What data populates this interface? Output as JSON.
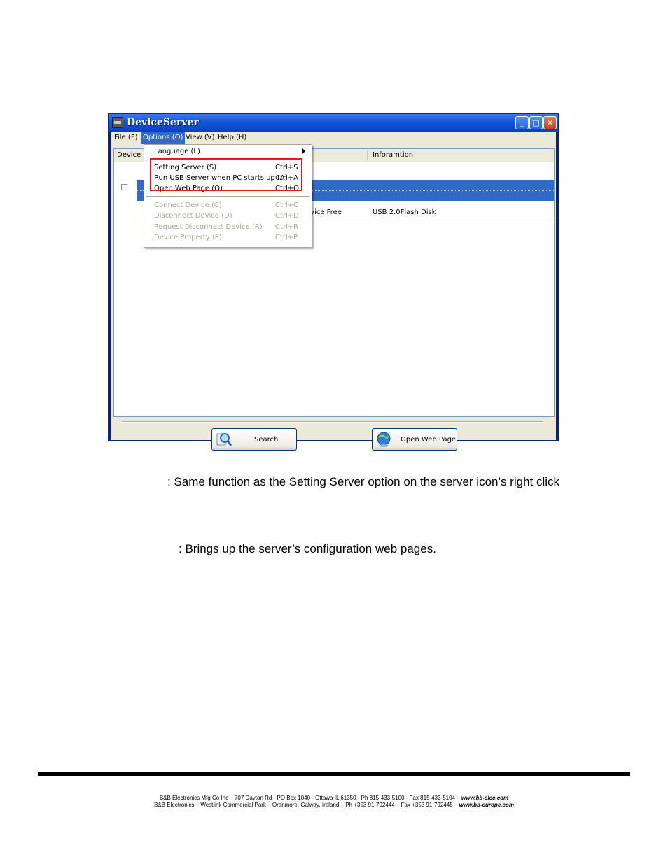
{
  "window": {
    "title": "DeviceServer",
    "minimize_glyph": "_",
    "maximize_glyph": "□",
    "close_glyph": "✕"
  },
  "menubar": {
    "items": [
      "File (F)",
      "Options (O)",
      "View (V)",
      "Help (H)"
    ]
  },
  "list": {
    "col_device": "Device",
    "col_information": "Inforamtion",
    "row_status": "evice Free",
    "row_information": "USB 2.0Flash Disk"
  },
  "options_menu": {
    "language": "Language (L)",
    "setting_server": "Setting Server (S)",
    "setting_server_sc": "Ctrl+S",
    "run_usb_server": "Run USB Server when PC starts up (A)",
    "run_usb_server_sc": "Ctrl+A",
    "open_web_page": "Open Web Page (O)",
    "open_web_page_sc": "Ctrl+O",
    "connect_device": "Connect Device (C)",
    "connect_device_sc": "Ctrl+C",
    "disconnect_device": "Disconnect Device (D)",
    "disconnect_device_sc": "Ctrl+D",
    "request_disconnect": "Request Disconnect Device (R)",
    "request_disconnect_sc": "Ctrl+R",
    "device_property": "Device Property (P)",
    "device_property_sc": "Ctrl+P"
  },
  "buttons": {
    "search": "Search",
    "open_web_page": "Open Web Page"
  },
  "descriptions": {
    "setting_server": ": Same function as the Setting Server option on the server icon’s right click",
    "open_web_page": ": Brings up the server’s configuration web pages."
  },
  "footer": {
    "line1_text": "B&B Electronics Mfg Co Inc – 707 Dayton Rd - PO Box 1040 - Ottawa IL 61350 - Ph 815-433-5100 - Fax 815-433-5104 – ",
    "line1_url": "www.bb-elec.com",
    "line2_text": "B&B Electronics – Westlink Commercial Park – Oranmore, Galway, Ireland – Ph +353 91-792444 – Fax +353 91-792445 – ",
    "line2_url": "www.bb-europe.com"
  }
}
